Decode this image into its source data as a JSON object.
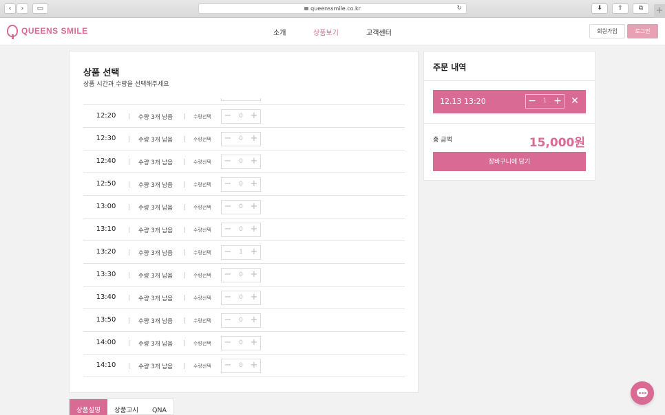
{
  "browser": {
    "url": "queenssmile.co.kr",
    "back_glyph": "‹",
    "forward_glyph": "›",
    "sidebar_glyph": "▭",
    "reload_glyph": "↻",
    "download_glyph": "⬇",
    "share_glyph": "⇧",
    "tabs_glyph": "⧉",
    "new_tab_glyph": "+"
  },
  "header": {
    "brand": "QUEENS SMILE",
    "nav": [
      {
        "label": "소개",
        "active": false
      },
      {
        "label": "상품보기",
        "active": true
      },
      {
        "label": "고객센터",
        "active": false
      }
    ],
    "join_label": "회원가입",
    "login_label": "로그인"
  },
  "product_select": {
    "title": "상품 선택",
    "subtitle": "상품 시간과 수량을 선택해주세요",
    "select_label": "수량선택",
    "minus": "−",
    "plus": "+",
    "slots": [
      {
        "time": "12:20",
        "remaining": "수량 3개 남음",
        "quantity": "0"
      },
      {
        "time": "12:30",
        "remaining": "수량 3개 남음",
        "quantity": "0"
      },
      {
        "time": "12:40",
        "remaining": "수량 3개 남음",
        "quantity": "0"
      },
      {
        "time": "12:50",
        "remaining": "수량 3개 남음",
        "quantity": "0"
      },
      {
        "time": "13:00",
        "remaining": "수량 3개 남음",
        "quantity": "0"
      },
      {
        "time": "13:10",
        "remaining": "수량 3개 남음",
        "quantity": "0"
      },
      {
        "time": "13:20",
        "remaining": "수량 3개 남음",
        "quantity": "1"
      },
      {
        "time": "13:30",
        "remaining": "수량 3개 남음",
        "quantity": "0"
      },
      {
        "time": "13:40",
        "remaining": "수량 3개 남음",
        "quantity": "0"
      },
      {
        "time": "13:50",
        "remaining": "수량 3개 남음",
        "quantity": "0"
      },
      {
        "time": "14:00",
        "remaining": "수량 3개 남음",
        "quantity": "0"
      },
      {
        "time": "14:10",
        "remaining": "수량 3개 남음",
        "quantity": "0"
      }
    ]
  },
  "tabs": [
    {
      "label": "상품설명",
      "active": true
    },
    {
      "label": "상품고시",
      "active": false
    },
    {
      "label": "QNA",
      "active": false
    }
  ],
  "order": {
    "title": "주문 내역",
    "item": {
      "datetime": "12.13 13:20",
      "quantity": "1",
      "minus": "−",
      "plus": "+",
      "remove": "✕"
    },
    "total_label": "총 금액",
    "total_value": "15,000원",
    "cart_label": "장바구니에 담기"
  },
  "colors": {
    "accent": "#d86a93",
    "accent_light": "#e8a0b5"
  }
}
